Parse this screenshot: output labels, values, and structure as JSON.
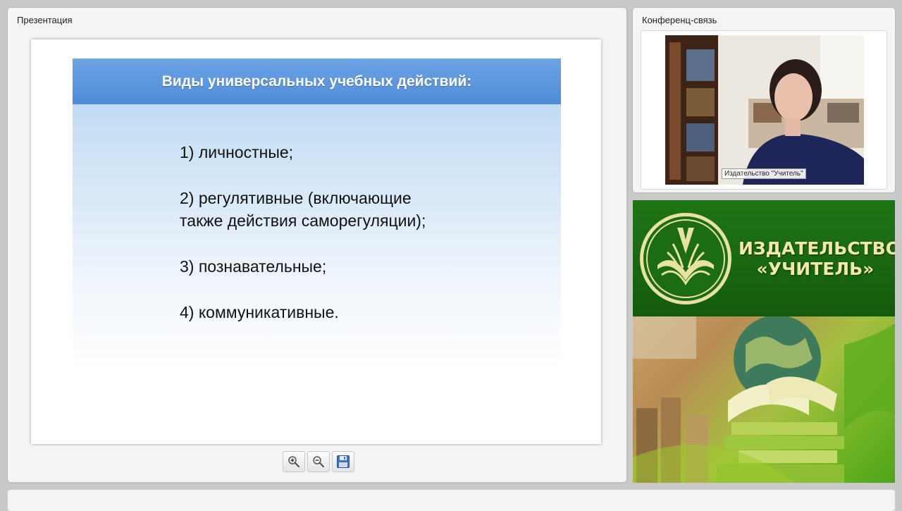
{
  "presentation": {
    "title": "Презентация",
    "slide": {
      "heading": "Виды универсальных учебных действий:",
      "items": [
        "1)  личностные;",
        "2) регулятивные (включающие",
        "также действия саморегуляции);",
        "3) познавательные;",
        "4) коммуникативные."
      ]
    },
    "toolbar": {
      "zoom_in_icon": "zoom-in-icon",
      "zoom_out_icon": "zoom-out-icon",
      "save_icon": "save-icon"
    }
  },
  "conference": {
    "title": "Конференц-связь",
    "video_label": "Издательство \"Учитель\""
  },
  "promo": {
    "line1": "ИЗДАТЕЛЬСТВО",
    "line2": "«УЧИТЕЛЬ»"
  },
  "colors": {
    "slide_header": "#5a96dd",
    "promo_green": "#1c6b12",
    "promo_text": "#f1e9a8"
  }
}
